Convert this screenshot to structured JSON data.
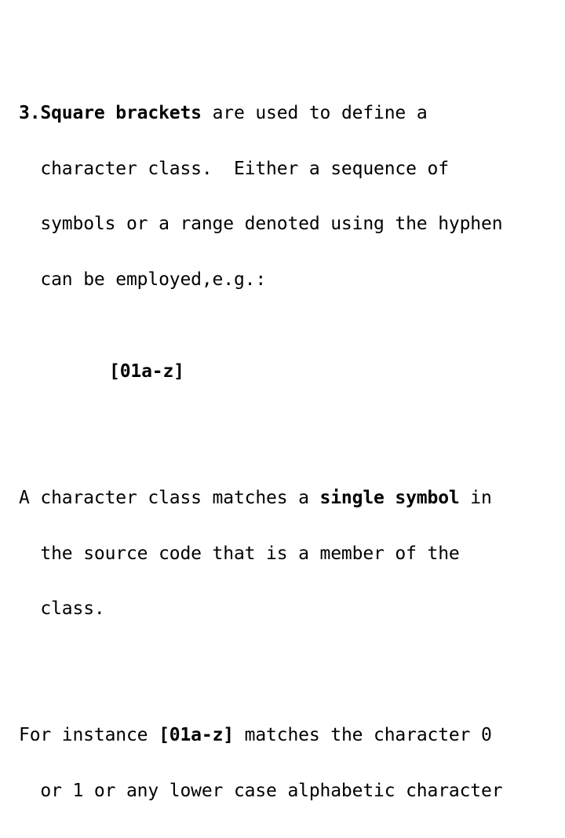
{
  "slide": {
    "background_color": "#ffffff",
    "text_color": "#000000",
    "item_number": "3.",
    "paragraph_1": {
      "bold_lead": "Square brackets",
      "line_1_rest": " are used to define a",
      "line_2": "character class.  Either a sequence of",
      "line_3": "symbols or a range denoted using the hyphen",
      "line_4": "can be employed,e.g.:"
    },
    "code_example": "[01a-z]",
    "paragraph_2": {
      "line_1_pre": "A character class matches a ",
      "line_1_bold": "single symbol",
      "line_1_post": " in",
      "line_2": "the source code that is a member of the",
      "line_3": "class."
    },
    "paragraph_3": {
      "line_1_pre": "For instance ",
      "line_1_bold": "[01a-z]",
      "line_1_post": " matches the character 0",
      "line_2": "or 1 or any lower case alphabetic character"
    }
  }
}
